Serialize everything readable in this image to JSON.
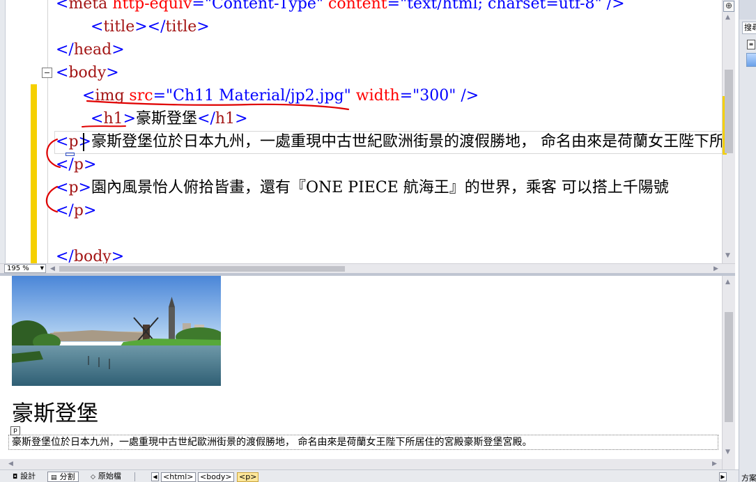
{
  "code_editor": {
    "lines": {
      "meta": {
        "open": "<",
        "name": "meta",
        "attr1": "http-equiv",
        "eq1": "=",
        "val1": "\"Content-Type\"",
        "attr2": "content",
        "eq2": "=",
        "val2": "\"text/html; charset=utf-8\"",
        "close": " />"
      },
      "title": {
        "open": "<",
        "name": "title",
        "mid": "></",
        "name2": "title",
        "close": ">"
      },
      "head_close": {
        "open": "</",
        "name": "head",
        "close": ">"
      },
      "body_open": {
        "open": "<",
        "name": "body",
        "close": ">"
      },
      "img": {
        "open": "<",
        "name": "img",
        "attr1": "src",
        "eq1": "=",
        "val1": "\"Ch11 Material/jp2.jpg\"",
        "attr2": "width",
        "eq2": "=",
        "val2": "\"300\"",
        "close": " />"
      },
      "h1": {
        "open": "<",
        "name": "h1",
        "gt": ">",
        "text": "豪斯登堡",
        "open2": "</",
        "name2": "h1",
        "close": ">"
      },
      "p1_open": {
        "open": "<",
        "name": "p",
        "gt": ">",
        "text": "豪斯登堡位於日本九州，一處重現中古世紀歐洲街景的渡假勝地，  命名由來是荷蘭女王陛下所居住的宮殿豪斯登堡宮殿。"
      },
      "p1_close": {
        "open": "</",
        "name": "p",
        "close": ">"
      },
      "p2_open": {
        "open": "<",
        "name": "p",
        "gt": ">",
        "text": "園內風景怡人俯拾皆畫，還有『ONE PIECE 航海王』的世界，乘客  可以搭上千陽號"
      },
      "p2_close": {
        "open": "</",
        "name": "p",
        "close": ">"
      },
      "body_close": {
        "open": "</",
        "name": "body",
        "close": ">"
      }
    }
  },
  "zoom": {
    "value": "195 %"
  },
  "design_view": {
    "heading": "豪斯登堡",
    "p_label": "p",
    "paragraph": "豪斯登堡位於日本九州，一處重現中古世紀歐洲街景的渡假勝地， 命名由來是荷蘭女王陛下所居住的宮殿豪斯登堡宮殿。"
  },
  "status_bar": {
    "tabs": [
      {
        "label": "設計",
        "icon": "design-view-icon"
      },
      {
        "label": "分割",
        "icon": "split-view-icon",
        "active": true
      },
      {
        "label": "原始檔",
        "icon": "source-view-icon"
      }
    ],
    "breadcrumbs": [
      "<html>",
      "<body>",
      "<p>"
    ],
    "selected_breadcrumb": "<p>"
  },
  "right_panel": {
    "search_placeholder": "搜尋",
    "bottom_text": "方案"
  },
  "colors": {
    "tag_delimiter": "#0000ff",
    "element_name": "#a31515",
    "attribute": "#ff0000",
    "attribute_value": "#0000ff",
    "change_marker": "#f5d000",
    "annotation_ink": "#e00000"
  }
}
